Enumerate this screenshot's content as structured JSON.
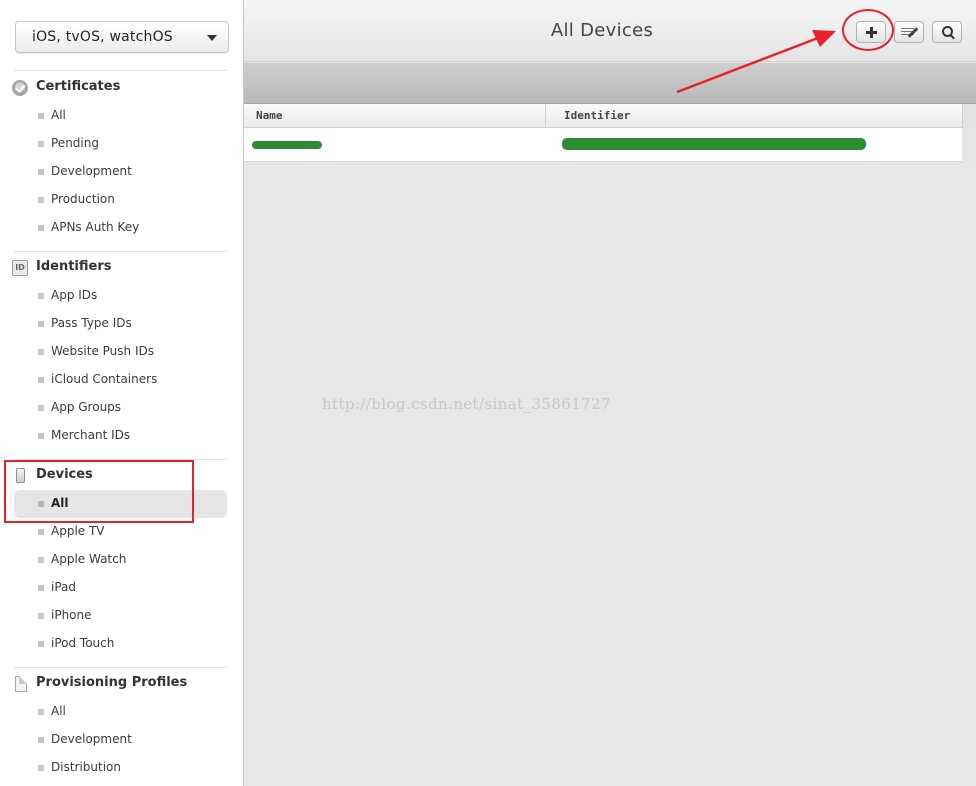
{
  "platform_select": {
    "value": "iOS, tvOS, watchOS"
  },
  "sidebar": {
    "sections": [
      {
        "title": "Certificates",
        "icon": "certificate-icon",
        "items": [
          "All",
          "Pending",
          "Development",
          "Production",
          "APNs Auth Key"
        ]
      },
      {
        "title": "Identifiers",
        "icon": "id-badge-icon",
        "icon_text": "ID",
        "items": [
          "App IDs",
          "Pass Type IDs",
          "Website Push IDs",
          "iCloud Containers",
          "App Groups",
          "Merchant IDs"
        ]
      },
      {
        "title": "Devices",
        "icon": "device-icon",
        "items": [
          "All",
          "Apple TV",
          "Apple Watch",
          "iPad",
          "iPhone",
          "iPod Touch"
        ],
        "active_item": "All"
      },
      {
        "title": "Provisioning Profiles",
        "icon": "document-icon",
        "items": [
          "All",
          "Development",
          "Distribution"
        ]
      }
    ]
  },
  "header": {
    "title": "All Devices",
    "buttons": [
      {
        "name": "add",
        "icon": "plus-icon"
      },
      {
        "name": "edit",
        "icon": "edit-icon"
      },
      {
        "name": "search",
        "icon": "search-icon"
      }
    ]
  },
  "table": {
    "columns": [
      "Name",
      "Identifier"
    ],
    "rows": [
      {
        "name": "[redacted]",
        "identifier": "[redacted]"
      }
    ]
  },
  "annotations": {
    "highlight_color": "#e8202a"
  },
  "watermark": "http://blog.csdn.net/sinat_35861727"
}
